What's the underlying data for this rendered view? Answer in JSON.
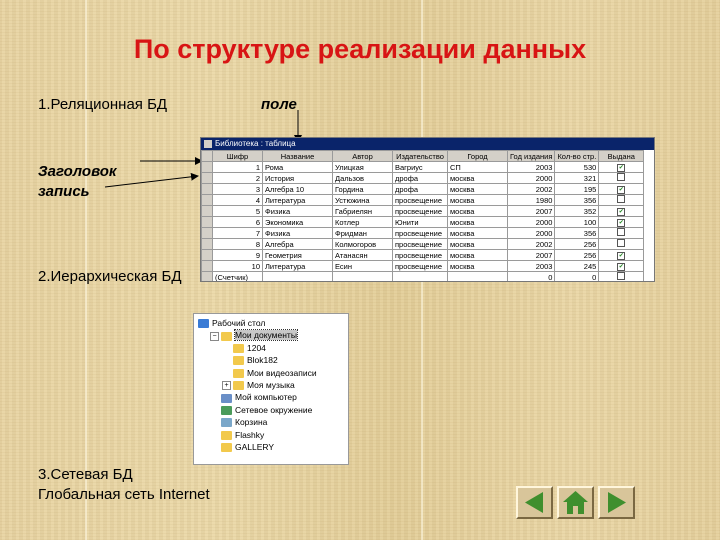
{
  "title": "По структуре реализации данных",
  "item1": "1.Реляционная БД",
  "field_label": "поле",
  "header_label": "Заголовок",
  "record_label": "запись",
  "item2": "2.Иерархическая БД",
  "item3_line1": "3.Сетевая БД",
  "item3_line2": "Глобальная сеть Internet",
  "table_window": {
    "title": "Библиотека : таблица",
    "columns": [
      "Шифр",
      "Название",
      "Автор",
      "Издательство",
      "Город",
      "Год издания",
      "Кол-во стр.",
      "Выдана"
    ],
    "rows": [
      [
        "1",
        "Рома",
        "Улицкая",
        "Вагриус",
        "СП",
        "2003",
        "530",
        "✔"
      ],
      [
        "2",
        "История",
        "Дальзов",
        "дрофа",
        "москва",
        "2000",
        "321",
        ""
      ],
      [
        "3",
        "Алгебра 10",
        "Гордина",
        "дрофа",
        "москва",
        "2002",
        "195",
        "✔"
      ],
      [
        "4",
        "Литература",
        "Устюжина",
        "просвещение",
        "москва",
        "1980",
        "356",
        ""
      ],
      [
        "5",
        "Физика",
        "Габриелян",
        "просвещение",
        "москва",
        "2007",
        "352",
        "✔"
      ],
      [
        "6",
        "Экономика",
        "Котлер",
        "Юнити",
        "москва",
        "2000",
        "100",
        "✔"
      ],
      [
        "7",
        "Физика",
        "Фридман",
        "просвещение",
        "москва",
        "2000",
        "356",
        ""
      ],
      [
        "8",
        "Алгебра",
        "Колмогоров",
        "просвещение",
        "москва",
        "2002",
        "256",
        ""
      ],
      [
        "9",
        "Геометрия",
        "Атанасян",
        "просвещение",
        "москва",
        "2007",
        "256",
        "✔"
      ],
      [
        "10",
        "Литература",
        "Есин",
        "просвещение",
        "москва",
        "2003",
        "245",
        "✔"
      ]
    ],
    "new_row": [
      "(Счетчик)",
      "",
      "",
      "",
      "",
      "0",
      "0",
      ""
    ]
  },
  "tree": {
    "items": [
      {
        "label": "Рабочий стол",
        "icon": "desktop-icon",
        "color": "#3a7bd5"
      },
      {
        "label": "Мои документы",
        "icon": "folder-icon",
        "color": "#f2c94c"
      },
      {
        "label": "1204",
        "icon": "folder-icon",
        "color": "#f2c94c"
      },
      {
        "label": "Blok182",
        "icon": "folder-icon",
        "color": "#f2c94c"
      },
      {
        "label": "Мои видеозаписи",
        "icon": "folder-icon",
        "color": "#f2c94c"
      },
      {
        "label": "Моя музыка",
        "icon": "folder-icon",
        "color": "#f2c94c"
      },
      {
        "label": "Мой компьютер",
        "icon": "computer-icon",
        "color": "#6a8fc7"
      },
      {
        "label": "Сетевое окружение",
        "icon": "network-icon",
        "color": "#4a9b5a"
      },
      {
        "label": "Корзина",
        "icon": "recycle-bin-icon",
        "color": "#7aa7c9"
      },
      {
        "label": "Flashky",
        "icon": "folder-icon",
        "color": "#f2c94c"
      },
      {
        "label": "GALLERY",
        "icon": "folder-icon",
        "color": "#f2c94c"
      }
    ]
  },
  "colors": {
    "title": "#d81414",
    "nav_button": "#d8c59a",
    "nav_arrow": "#3f8f2e"
  }
}
